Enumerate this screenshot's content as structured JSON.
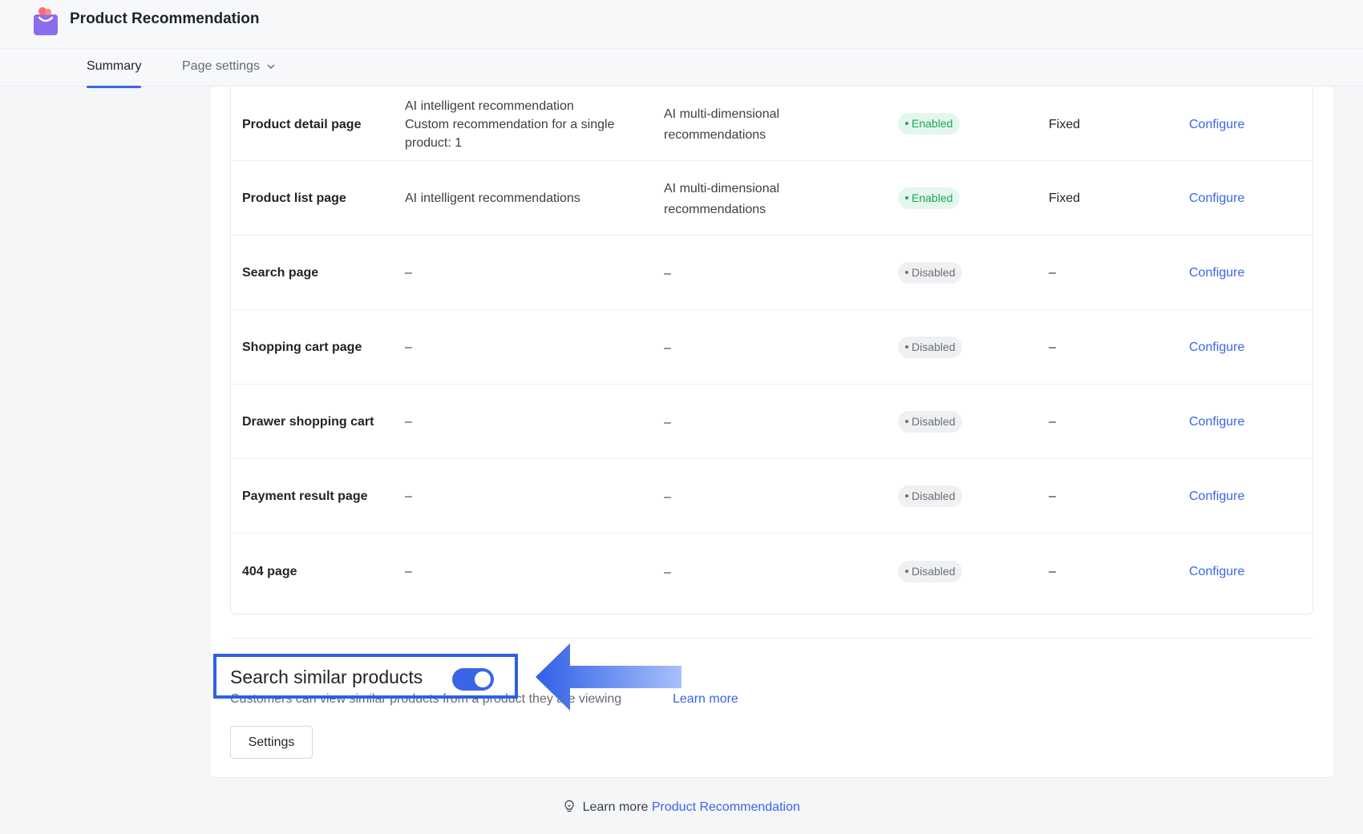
{
  "app": {
    "title": "Product Recommendation"
  },
  "tabs": [
    {
      "label": "Summary",
      "active": true
    },
    {
      "label": "Page settings",
      "active": false
    }
  ],
  "table": {
    "rows": [
      {
        "page": "Product detail page",
        "recommendation": [
          "AI intelligent recommendation",
          "Custom recommendation for a single product: 1"
        ],
        "algorithm": [
          "AI multi-dimensional",
          "recommendations"
        ],
        "status": "Enabled",
        "position": "Fixed",
        "action": "Configure"
      },
      {
        "page": "Product list page",
        "recommendation": [
          "AI intelligent recommendations"
        ],
        "algorithm": [
          "AI multi-dimensional",
          "recommendations"
        ],
        "status": "Enabled",
        "position": "Fixed",
        "action": "Configure"
      },
      {
        "page": "Search page",
        "recommendation": [
          "–"
        ],
        "algorithm": [
          "–"
        ],
        "status": "Disabled",
        "position": "–",
        "action": "Configure"
      },
      {
        "page": "Shopping cart page",
        "recommendation": [
          "–"
        ],
        "algorithm": [
          "–"
        ],
        "status": "Disabled",
        "position": "–",
        "action": "Configure"
      },
      {
        "page": "Drawer shopping cart",
        "recommendation": [
          "–"
        ],
        "algorithm": [
          "–"
        ],
        "status": "Disabled",
        "position": "–",
        "action": "Configure"
      },
      {
        "page": "Payment result page",
        "recommendation": [
          "–"
        ],
        "algorithm": [
          "–"
        ],
        "status": "Disabled",
        "position": "–",
        "action": "Configure"
      },
      {
        "page": "404 page",
        "recommendation": [
          "–"
        ],
        "algorithm": [
          "–"
        ],
        "status": "Disabled",
        "position": "–",
        "action": "Configure"
      }
    ]
  },
  "feature": {
    "title": "Search similar products",
    "toggle_on": true,
    "description": "Customers can view similar products from a product they are viewing",
    "learn_more": "Learn more",
    "settings_button": "Settings"
  },
  "footer": {
    "prefix": "Learn more",
    "link": "Product Recommendation"
  },
  "colors": {
    "accent": "#3b65e8",
    "enabled_bg": "#e3f7ec",
    "enabled_text": "#22a35a",
    "disabled_bg": "#eff0f2",
    "annotation_blue": "#2f5fe6"
  },
  "icons": {
    "logo": "shopping-bag-icon",
    "tab_chevron": "chevron-down-icon",
    "footer": "lightbulb-icon"
  }
}
